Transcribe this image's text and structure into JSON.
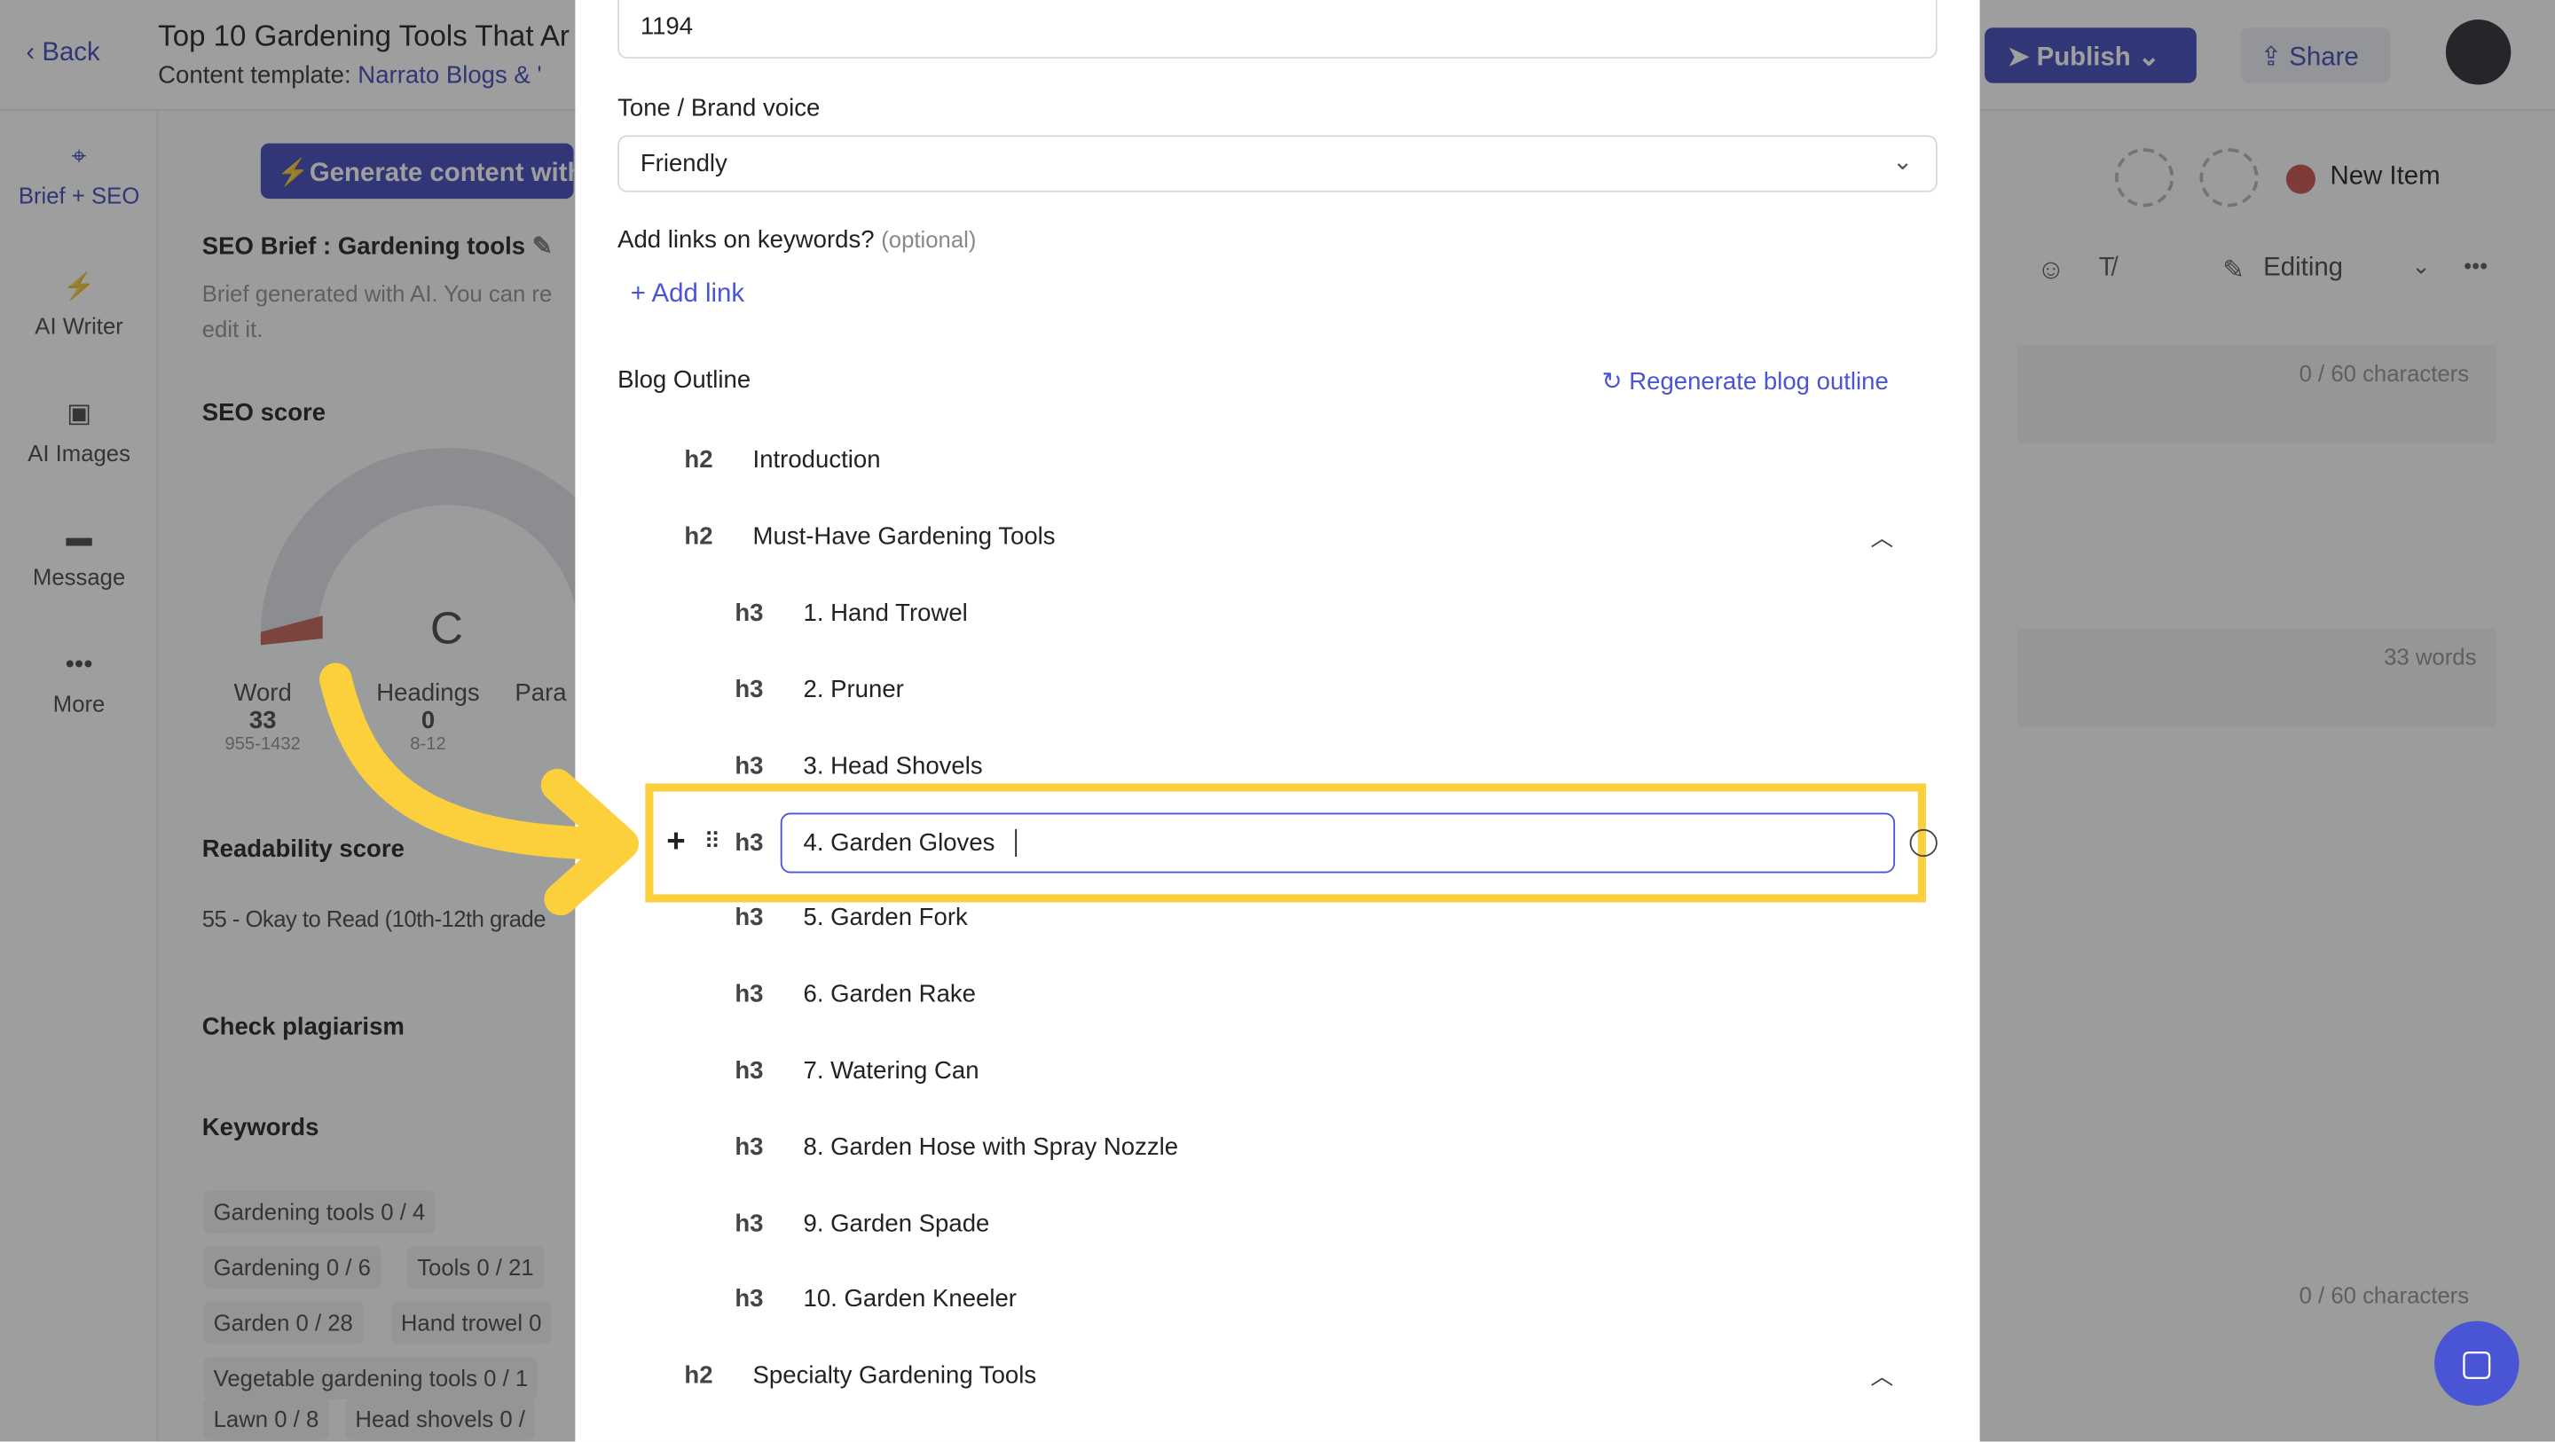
{
  "header": {
    "back": "Back",
    "title": "Top 10 Gardening Tools That Ar",
    "template_label": "Content template:",
    "template_value": "Narrato Blogs & '",
    "publish": "Publish",
    "share": "Share"
  },
  "sidebar": {
    "items": [
      {
        "label": "Brief + SEO",
        "icon": "target-icon"
      },
      {
        "label": "AI Writer",
        "icon": "bolt-icon"
      },
      {
        "label": "AI Images",
        "icon": "image-icon"
      },
      {
        "label": "Message",
        "icon": "message-icon"
      },
      {
        "label": "More",
        "icon": "more-icon"
      }
    ]
  },
  "brief": {
    "generate": "Generate content with",
    "title": "SEO Brief : Gardening tools",
    "desc1": "Brief generated with AI. You can re",
    "desc2": "edit it.",
    "seo_score": "SEO score",
    "grade": "C",
    "metrics": [
      {
        "label": "Word",
        "value": "33",
        "range": "955-1432"
      },
      {
        "label": "Headings",
        "value": "0",
        "range": "8-12"
      },
      {
        "label": "Para",
        "value": "",
        "range": ""
      }
    ],
    "readability_title": "Readability score",
    "readability_value": "55 - Okay to Read (10th-12th grade",
    "plagiarism": "Check plagiarism",
    "keywords_title": "Keywords",
    "keywords": [
      "Gardening tools  0 / 4",
      "Gardening  0 / 6",
      "Tools  0 / 21",
      "Garden  0 / 28",
      "Hand trowel  0",
      "Vegetable gardening tools  0 / 1",
      "Lawn  0 / 8",
      "Head shovels  0 /"
    ]
  },
  "editor": {
    "status": "New Item",
    "status_color": "#e05a55",
    "mode": "Editing",
    "chars1": "0 / 60 characters",
    "words": "33 words",
    "chars2": "0 / 60 characters"
  },
  "modal": {
    "word_count_value": "1194",
    "tone_label": "Tone / Brand voice",
    "tone_value": "Friendly",
    "links_label": "Add links on keywords?",
    "links_optional": "(optional)",
    "add_link": "Add link",
    "outline_title": "Blog Outline",
    "regenerate": "Regenerate blog outline",
    "outline": [
      {
        "level": "h2",
        "text": "Introduction"
      },
      {
        "level": "h2",
        "text": "Must-Have Gardening Tools"
      },
      {
        "level": "h3",
        "text": "1. Hand Trowel"
      },
      {
        "level": "h3",
        "text": "2. Pruner"
      },
      {
        "level": "h3",
        "text": "3. Head Shovels"
      },
      {
        "level": "h3",
        "text": "4. Garden Gloves"
      },
      {
        "level": "h3",
        "text": "5. Garden Fork"
      },
      {
        "level": "h3",
        "text": "6. Garden Rake"
      },
      {
        "level": "h3",
        "text": "7. Watering Can"
      },
      {
        "level": "h3",
        "text": "8. Garden Hose with Spray Nozzle"
      },
      {
        "level": "h3",
        "text": "9. Garden Spade"
      },
      {
        "level": "h3",
        "text": "10. Garden Kneeler"
      },
      {
        "level": "h2",
        "text": "Specialty Gardening Tools"
      }
    ]
  },
  "colors": {
    "accent": "#4a55d6",
    "highlight": "#fcd03d",
    "overlay": "#3c425a"
  }
}
